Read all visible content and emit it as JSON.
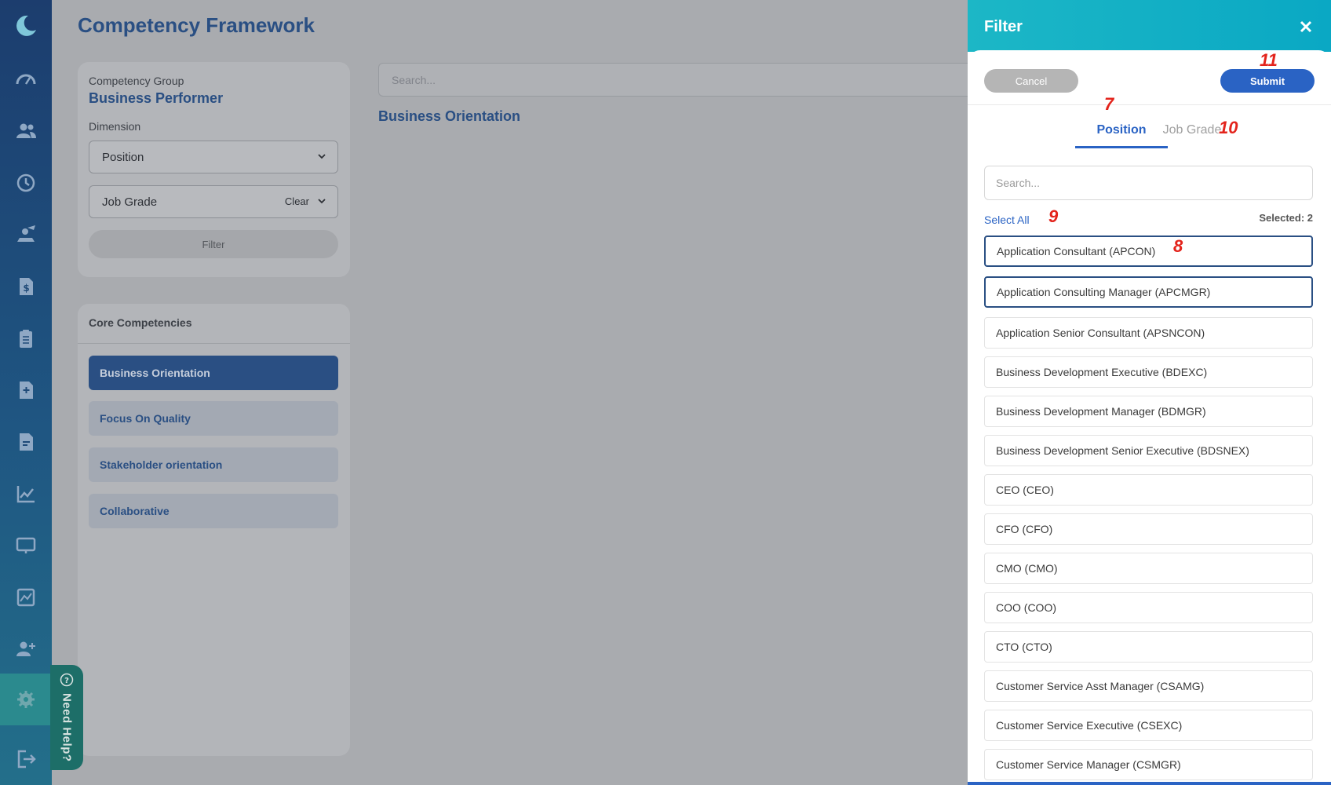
{
  "app": {
    "page_title": "Competency Framework"
  },
  "left_panel": {
    "group_label": "Competency Group",
    "group_name": "Business Performer",
    "dimension_label": "Dimension",
    "dimension_value": "Position",
    "job_grade_value": "Job Grade",
    "clear_label": "Clear",
    "filter_label": "Filter",
    "core_title": "Core Competencies",
    "competencies": [
      "Business Orientation",
      "Focus On Quality",
      "Stakeholder orientation",
      "Collaborative"
    ]
  },
  "main": {
    "search_placeholder": "Search...",
    "heading": "Business Orientation"
  },
  "help": {
    "label": "Need Help?"
  },
  "drawer": {
    "title": "Filter",
    "cancel_label": "Cancel",
    "submit_label": "Submit",
    "tabs": [
      "Position",
      "Job Grade"
    ],
    "search_placeholder": "Search...",
    "select_all_label": "Select All",
    "selected_count_label": "Selected: 2",
    "options": [
      {
        "label": "Application Consultant (APCON)",
        "selected": true
      },
      {
        "label": "Application Consulting Manager (APCMGR)",
        "selected": true
      },
      {
        "label": "Application Senior Consultant (APSNCON)",
        "selected": false
      },
      {
        "label": "Business Development Executive (BDEXC)",
        "selected": false
      },
      {
        "label": "Business Development Manager (BDMGR)",
        "selected": false
      },
      {
        "label": "Business Development Senior Executive (BDSNEX)",
        "selected": false
      },
      {
        "label": "CEO (CEO)",
        "selected": false
      },
      {
        "label": "CFO (CFO)",
        "selected": false
      },
      {
        "label": "CMO (CMO)",
        "selected": false
      },
      {
        "label": "COO (COO)",
        "selected": false
      },
      {
        "label": "CTO (CTO)",
        "selected": false
      },
      {
        "label": "Customer Service Asst Manager (CSAMG)",
        "selected": false
      },
      {
        "label": "Customer Service Executive (CSEXC)",
        "selected": false
      },
      {
        "label": "Customer Service Manager (CSMGR)",
        "selected": false
      }
    ]
  },
  "markers": [
    "7",
    "8",
    "9",
    "10",
    "11"
  ],
  "nav_icons": [
    "moon-logo-icon",
    "dashboard-icon",
    "people-icon",
    "history-icon",
    "training-icon",
    "payroll-icon",
    "clipboard-icon",
    "document-plus-icon",
    "report-icon",
    "chart-icon",
    "monitor-icon",
    "analytics-icon",
    "add-user-icon",
    "settings-icon",
    "logout-icon"
  ],
  "colors": {
    "brand": "#2a4f83",
    "accent": "#2a63c4",
    "header": "#1cb7c6",
    "marker": "#e3241c"
  }
}
